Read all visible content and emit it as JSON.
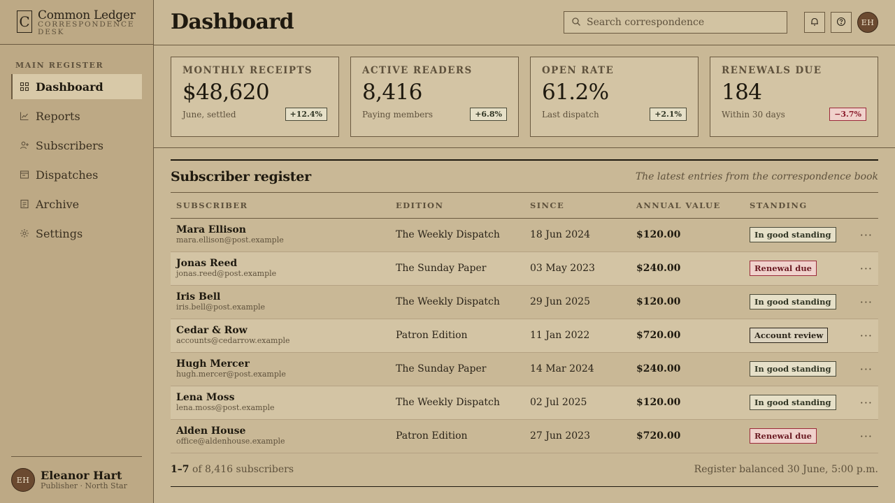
{
  "brand": {
    "mark": "C",
    "name": "Common Ledger",
    "sub": "CORRESPONDENCE DESK"
  },
  "sidebar": {
    "section_label": "MAIN REGISTER",
    "items": [
      {
        "label": "Dashboard",
        "icon": "grid-icon",
        "active": true
      },
      {
        "label": "Reports",
        "icon": "chart-icon"
      },
      {
        "label": "Subscribers",
        "icon": "user-plus-icon"
      },
      {
        "label": "Dispatches",
        "icon": "window-icon"
      },
      {
        "label": "Archive",
        "icon": "document-icon"
      },
      {
        "label": "Settings",
        "icon": "gear-icon"
      }
    ]
  },
  "user": {
    "initials": "EH",
    "name": "Eleanor Hart",
    "role": "Publisher · North Star"
  },
  "header": {
    "title": "Dashboard",
    "search_placeholder": "Search correspondence",
    "avatar_initials": "EH"
  },
  "stats": [
    {
      "label": "MONTHLY RECEIPTS",
      "value": "$48,620",
      "note": "June, settled",
      "delta": "+12.4%"
    },
    {
      "label": "ACTIVE READERS",
      "value": "8,416",
      "note": "Paying members",
      "delta": "+6.8%"
    },
    {
      "label": "OPEN RATE",
      "value": "61.2%",
      "note": "Last dispatch",
      "delta": "+2.1%"
    },
    {
      "label": "RENEWALS DUE",
      "value": "184",
      "note": "Within 30 days",
      "delta": "−3.7%"
    }
  ],
  "register": {
    "title": "Subscriber register",
    "subtitle": "The latest entries from the correspondence book",
    "columns": [
      "SUBSCRIBER",
      "EDITION",
      "SINCE",
      "ANNUAL VALUE",
      "STANDING"
    ],
    "rows": [
      {
        "name": "Mara Ellison",
        "email": "mara.ellison@post.example",
        "edition": "The Weekly Dispatch",
        "since": "18 Jun 2024",
        "value": "$120.00",
        "standing": "In good standing"
      },
      {
        "name": "Jonas Reed",
        "email": "jonas.reed@post.example",
        "edition": "The Sunday Paper",
        "since": "03 May 2023",
        "value": "$240.00",
        "standing": "Renewal due"
      },
      {
        "name": "Iris Bell",
        "email": "iris.bell@post.example",
        "edition": "The Weekly Dispatch",
        "since": "29 Jun 2025",
        "value": "$120.00",
        "standing": "In good standing"
      },
      {
        "name": "Cedar & Row",
        "email": "accounts@cedarrow.example",
        "edition": "Patron Edition",
        "since": "11 Jan 2022",
        "value": "$720.00",
        "standing": "Account review"
      },
      {
        "name": "Hugh Mercer",
        "email": "hugh.mercer@post.example",
        "edition": "The Sunday Paper",
        "since": "14 Mar 2024",
        "value": "$240.00",
        "standing": "In good standing"
      },
      {
        "name": "Lena Moss",
        "email": "lena.moss@post.example",
        "edition": "The Weekly Dispatch",
        "since": "02 Jul 2025",
        "value": "$120.00",
        "standing": "In good standing"
      },
      {
        "name": "Alden House",
        "email": "office@aldenhouse.example",
        "edition": "Patron Edition",
        "since": "27 Jun 2023",
        "value": "$720.00",
        "standing": "Renewal due"
      }
    ],
    "more_label": "···",
    "range": "1–7",
    "range_suffix": "of 8,416 subscribers",
    "balance_note": "Register balanced 30 June, 5:00 p.m."
  }
}
